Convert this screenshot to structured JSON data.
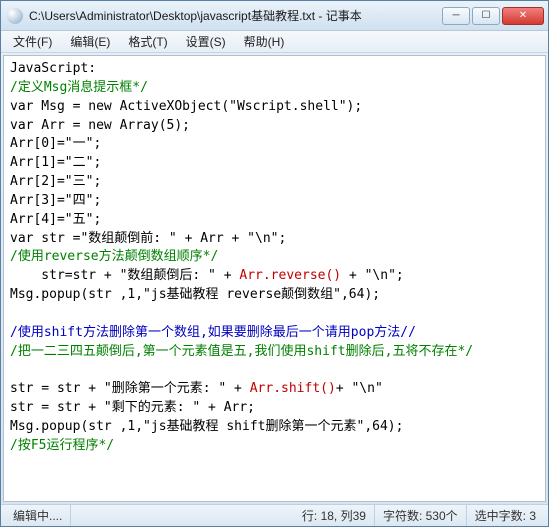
{
  "titlebar": {
    "title": "C:\\Users\\Administrator\\Desktop\\javascript基础教程.txt - 记事本"
  },
  "menu": {
    "file": "文件(F)",
    "edit": "编辑(E)",
    "format": "格式(T)",
    "settings": "设置(S)",
    "help": "帮助(H)"
  },
  "code": {
    "l1": "JavaScript:",
    "l2": "/定义Msg消息提示框*/",
    "l3": "var Msg = new ActiveXObject(\"Wscript.shell\");",
    "l4": "var Arr = new Array(5);",
    "l5": "Arr[0]=\"一\";",
    "l6": "Arr[1]=\"二\";",
    "l7": "Arr[2]=\"三\";",
    "l8": "Arr[3]=\"四\";",
    "l9": "Arr[4]=\"五\";",
    "l10": "var str =\"数组颠倒前: \" + Arr + \"\\n\";",
    "l11": "/使用reverse方法颠倒数组顺序*/",
    "l12a": "    str=str + \"数组颠倒后: \" + ",
    "l12b": "Arr.reverse()",
    "l12c": " + \"\\n\";",
    "l13": "Msg.popup(str ,1,\"js基础教程 reverse颠倒数组\",64);",
    "l14": "",
    "l15": "/使用shift方法删除第一个数组,如果要删除最后一个请用pop方法//",
    "l16": "/把一二三四五颠倒后,第一个元素值是五,我们使用shift删除后,五将不存在*/",
    "l17": "",
    "l18a": "str = str + \"删除第一个元素: \" + ",
    "l18b": "Arr.shift()",
    "l18c": "+ \"\\n\"",
    "l19": "str = str + \"剩下的元素: \" + Arr;",
    "l20": "Msg.popup(str ,1,\"js基础教程 shift删除第一个元素\",64);",
    "l21": "/按F5运行程序*/"
  },
  "status": {
    "editing": "编辑中....",
    "line_col": "行: 18, 列39",
    "chars": "字符数: 530个",
    "selected": "选中字数: 3"
  }
}
